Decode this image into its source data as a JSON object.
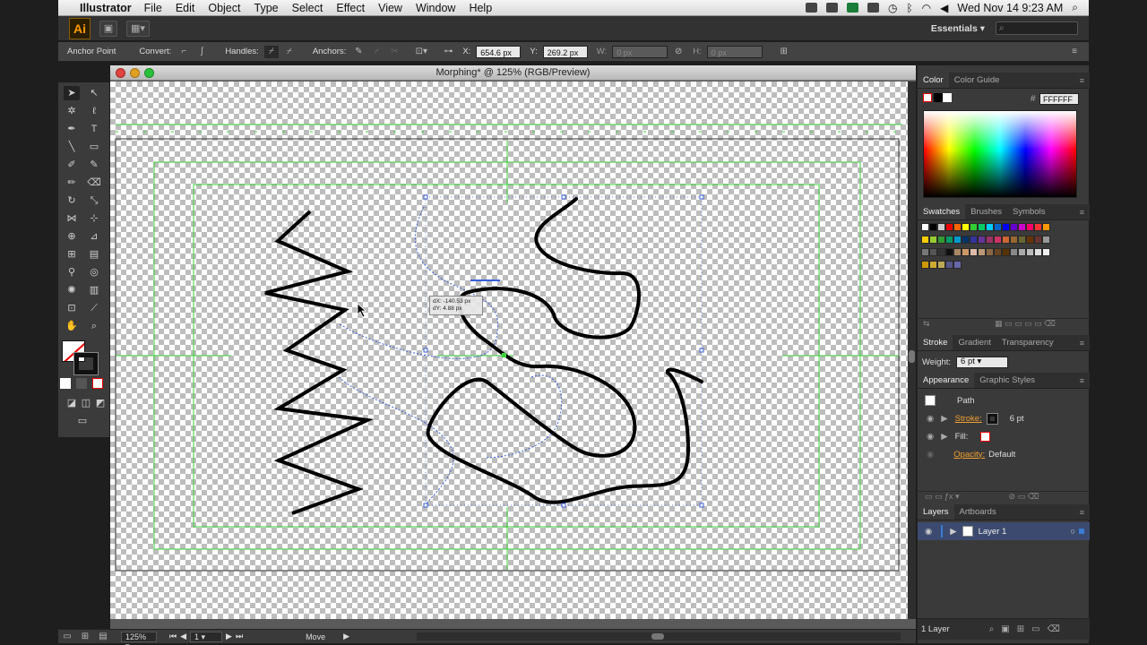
{
  "menubar": {
    "app_name": "Illustrator",
    "items": [
      "File",
      "Edit",
      "Object",
      "Type",
      "Select",
      "Effect",
      "View",
      "Window",
      "Help"
    ],
    "clock": "Wed Nov 14  9:23 AM"
  },
  "appbar": {
    "logo": "Ai",
    "workspace": "Essentials",
    "search_placeholder": "⌕"
  },
  "controlbar": {
    "tool_name": "Anchor Point",
    "convert_label": "Convert:",
    "handles_label": "Handles:",
    "anchors_label": "Anchors:",
    "x_label": "X:",
    "x_value": "654.6 px",
    "y_label": "Y:",
    "y_value": "269.2 px",
    "w_label": "W:",
    "w_value": "0 px",
    "h_label": "H:",
    "h_value": "0 px"
  },
  "document": {
    "title": "Morphing* @ 125% (RGB/Preview)",
    "tooltip_dx": "dX: -140.53 px",
    "tooltip_dy": "dY: 4.88 px"
  },
  "statusbar": {
    "zoom": "125%",
    "artboard": "1",
    "status": "Move"
  },
  "panels": {
    "color_tabs": [
      "Color",
      "Color Guide"
    ],
    "hex_value": "FFFFFF",
    "swatch_tabs": [
      "Swatches",
      "Brushes",
      "Symbols"
    ],
    "stroke_tabs": [
      "Stroke",
      "Gradient",
      "Transparency"
    ],
    "weight_label": "Weight:",
    "weight_value": "6 pt",
    "appearance_tabs": [
      "Appearance",
      "Graphic Styles"
    ],
    "appearance_path": "Path",
    "stroke_label": "Stroke:",
    "stroke_value": "6 pt",
    "fill_label": "Fill:",
    "opacity_label": "Opacity:",
    "opacity_value": "Default",
    "layers_tabs": [
      "Layers",
      "Artboards"
    ],
    "layer_name": "Layer 1",
    "layers_count": "1 Layer"
  },
  "colors": {
    "accent_orange": "#f0a030",
    "guide_green": "#3bd33b",
    "path_blue": "#3a5fd8",
    "layer_highlight": "#3b4a6e"
  }
}
